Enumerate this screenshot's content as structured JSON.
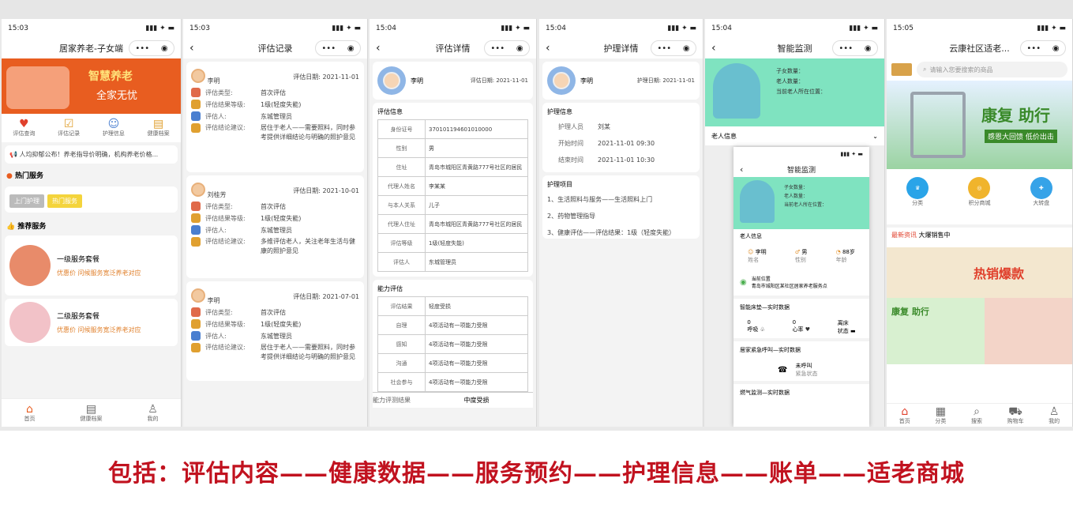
{
  "caption": "包括：评估内容——健康数据——服务预约——护理信息——账单——适老商城",
  "s1": {
    "time": "15:03",
    "title": "居家养老-子女端",
    "banner_title": "智慧养老",
    "banner_sub": "全家无忧",
    "icons": [
      "评估查询",
      "评估记录",
      "护理信息",
      "健康档案"
    ],
    "notice": "人均抑郁公布！养老指导价明确，机构养老价格...",
    "hot_title": "热门服务",
    "hot_btn1": "上门护理",
    "hot_btn2": "热门服务",
    "rec_title": "推荐服务",
    "rec_items": [
      {
        "name": "一级服务套餐",
        "sub": "优惠价 问候服务宽泛养老对应"
      },
      {
        "name": "二级服务套餐",
        "sub": "优惠价 问候服务宽泛养老对应"
      }
    ],
    "tabs": [
      "首页",
      "健康档案",
      "我的"
    ]
  },
  "s2": {
    "time": "15:03",
    "title": "评估记录",
    "records": [
      {
        "name": "李明",
        "date": "评估日期: 2021-11-01",
        "type": "首次评估",
        "result": "1级(轻度失能)",
        "person": "东城管理员",
        "advice": "居住于老人——需要照料，同时参考提供详细结论与明确的照护意见",
        "date_label": "评估日期"
      },
      {
        "name": "刘桂芳",
        "date": "评估日期: 2021-10-01",
        "type": "首次评估",
        "result": "1级(轻度失能)",
        "person": "东城管理员",
        "advice": "多维评估老人，关注老年生活与健康的照护意见",
        "date_label": "评估日期"
      },
      {
        "name": "李明",
        "date": "评估日期: 2021-07-01",
        "type": "首次评估",
        "result": "1级(轻度失能)",
        "person": "东城管理员",
        "advice": "居住于老人——需要照料，同时参考提供详细结论与明确的照护意见",
        "date_label": "评估日期"
      }
    ],
    "labels": [
      "评估类型:",
      "评估结果等级:",
      "评估人:",
      "评估结论建议:"
    ]
  },
  "s3": {
    "time": "15:04",
    "title": "评估详情",
    "name": "李明",
    "date": "评估日期: 2021-11-01",
    "section1": "评估信息",
    "rows1": [
      [
        "身份证号",
        "370101194601010000"
      ],
      [
        "性别",
        "男"
      ],
      [
        "住址",
        "青岛市城阳区青黄路777号社区的居民"
      ],
      [
        "代理人姓名",
        "李某某"
      ],
      [
        "与本人关系",
        "儿子"
      ],
      [
        "代理人住址",
        "青岛市城阳区青黄路777号社区的居民"
      ],
      [
        "评估等级",
        "1级(轻度失能)"
      ],
      [
        "评估人",
        "东城管理员"
      ]
    ],
    "section2": "能力评估",
    "rows2": [
      [
        "评估结果",
        "轻度受损"
      ],
      [
        "自理",
        "4项活动有一项能力受限"
      ],
      [
        "感知",
        "4项活动有一项能力受限"
      ],
      [
        "沟通",
        "4项活动有一项能力受限"
      ],
      [
        "社会参与",
        "4项活动有一项能力受限"
      ]
    ],
    "footer_left": "能力评测结果",
    "footer_right": "中度受损"
  },
  "s4": {
    "time": "15:04",
    "title": "护理详情",
    "name": "李明",
    "date": "护理日期: 2021-11-01",
    "info_title": "护理信息",
    "info_rows": [
      [
        "护理人员",
        "刘某"
      ],
      [
        "开始时间",
        "2021-11-01 09:30"
      ],
      [
        "结束时间",
        "2021-11-01 10:30"
      ]
    ],
    "items_title": "护理项目",
    "items": [
      "1、生活照料与服务——生活照料上门",
      "2、药物管理指导",
      "3、健康评估——评估结果：1级（轻度失能）"
    ]
  },
  "s5": {
    "time": "15:04",
    "title": "智能监测",
    "info": [
      "子女数量：",
      "老人数量：",
      "当前老人所在位置："
    ],
    "panel_title": "老人信息",
    "inner_title": "智能监测",
    "inner_info": [
      "子女数量：",
      "老人数量：",
      "当前老人所在位置："
    ],
    "inner_panel": "老人信息",
    "stats": [
      [
        "李明",
        "姓名"
      ],
      [
        "男",
        "性别"
      ],
      [
        "88岁",
        "年龄"
      ]
    ],
    "location_label": "当前位置",
    "location": "青岛市城阳区某社区居家养老服务点",
    "vitals_title": "智能床垫—实时数据",
    "vitals": [
      "0",
      "0",
      "离床"
    ],
    "vitals_labels": [
      "呼吸",
      "心率",
      "状态"
    ],
    "sos_title": "居家紧急呼叫—实时数据",
    "sos_label": "未呼叫",
    "sos_sub": "紧急状态",
    "bottom_title": "燃气监测—实时数据"
  },
  "s6": {
    "time": "15:05",
    "title": "云康社区适老...",
    "search": "请输入您要搜索的商品",
    "banner_title": "康复 助行",
    "banner_sub": "感恩大回馈 低价出击",
    "icons": [
      "分类",
      "积分商城",
      "大转盘"
    ],
    "notice1": "最新资讯",
    "notice2": "大爆销售中",
    "hot_text": "热销爆款",
    "promo": "康复 助行",
    "tabs": [
      "首页",
      "分类",
      "搜索",
      "购物车",
      "我的"
    ]
  }
}
